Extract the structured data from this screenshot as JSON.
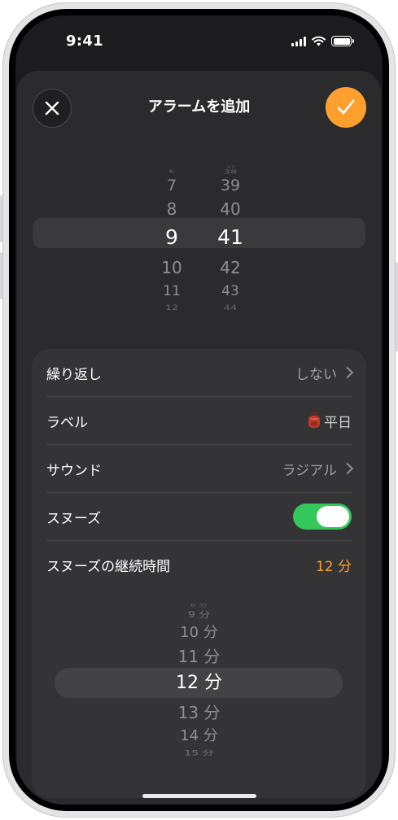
{
  "status": {
    "time": "9:41"
  },
  "nav": {
    "title": "アラームを追加"
  },
  "picker": {
    "hours": [
      "6",
      "7",
      "8",
      "9",
      "10",
      "11",
      "12"
    ],
    "minutes": [
      "37",
      "38",
      "39",
      "40",
      "41",
      "42",
      "43",
      "44"
    ],
    "selected_hour": "9",
    "selected_minute": "41"
  },
  "settings": {
    "repeat_label": "繰り返し",
    "repeat_value": "しない",
    "label_label": "ラベル",
    "label_value": "平日",
    "sound_label": "サウンド",
    "sound_value": "ラジアル",
    "snooze_label": "スヌーズ",
    "snooze_on": true,
    "snooze_duration_label": "スヌーズの継続時間",
    "snooze_duration_value": "12 分"
  },
  "snooze_picker": {
    "options": [
      "8 分",
      "9 分",
      "10 分",
      "11 分",
      "12 分",
      "13 分",
      "14 分",
      "15 分"
    ],
    "selected": "12 分"
  },
  "colors": {
    "accent": "#ff9f2e",
    "toggle_on": "#34c759",
    "background": "#1c1c1e"
  }
}
